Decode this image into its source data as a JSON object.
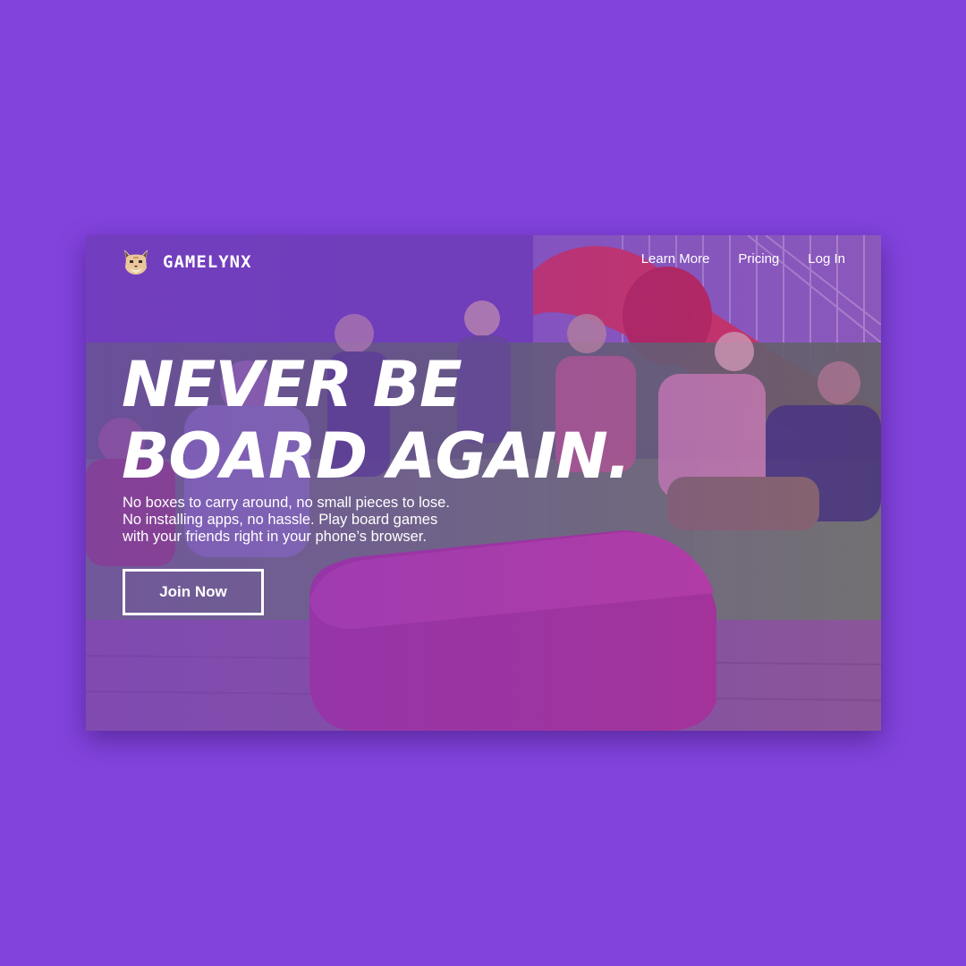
{
  "brand": {
    "name": "GAMELYNX",
    "logo_icon": "lynx-face-icon"
  },
  "nav": {
    "items": [
      {
        "label": "Learn More"
      },
      {
        "label": "Pricing"
      },
      {
        "label": "Log In"
      }
    ]
  },
  "hero": {
    "headline_line1": "NEVER BE",
    "headline_line2": "BOARD AGAIN.",
    "subtext_line1": "No boxes to carry around, no small pieces to lose.",
    "subtext_line2": "No installing apps, no hassle. Play board games",
    "subtext_line3": "with your friends right in your phone’s browser.",
    "cta_label": "Join Now"
  },
  "colors": {
    "background": "#8243dd",
    "overlay": "#763ccd",
    "text": "#ffffff"
  }
}
